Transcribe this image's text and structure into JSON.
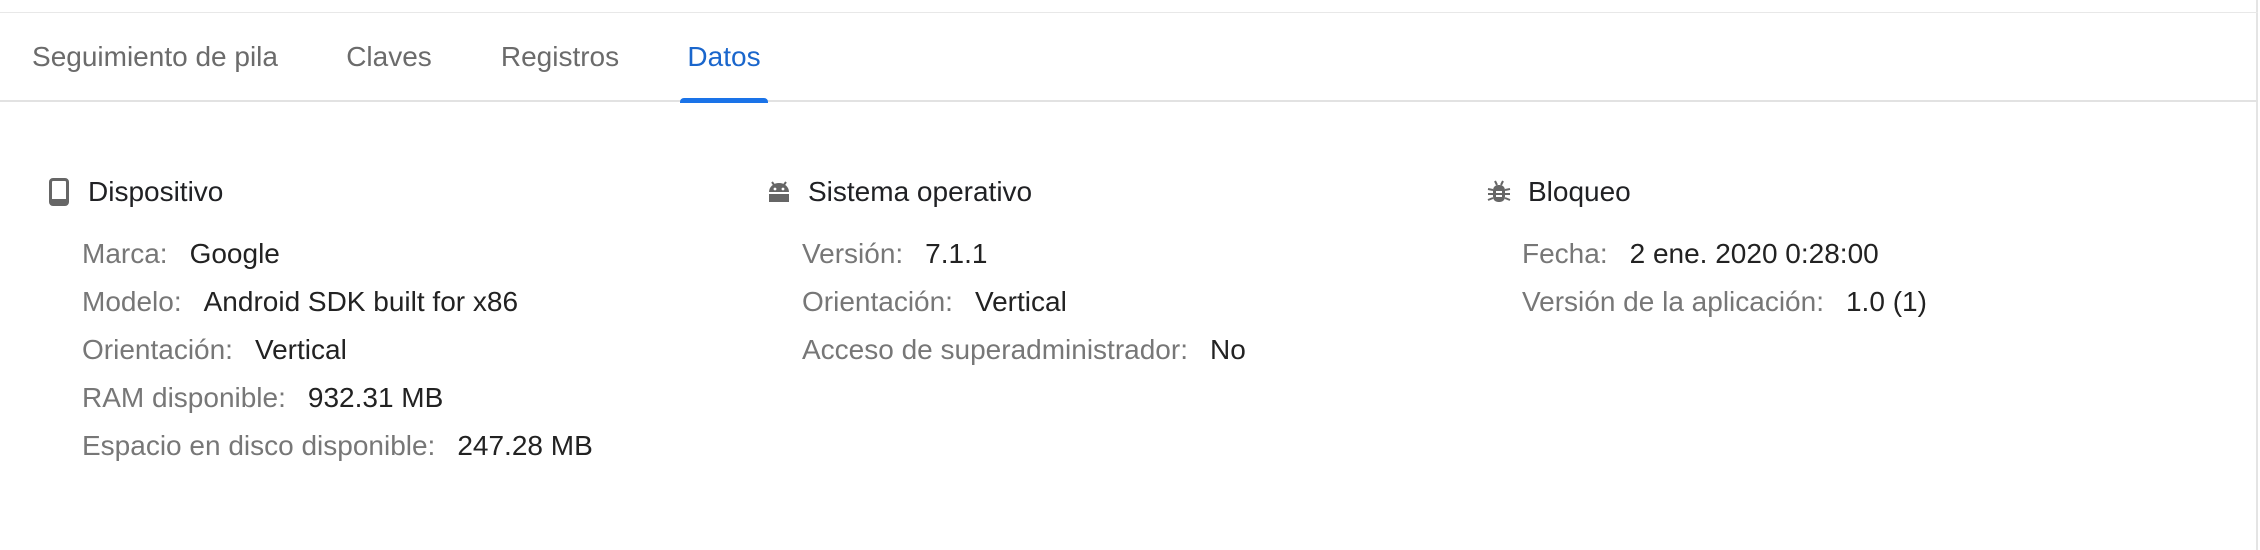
{
  "tabs": [
    {
      "label": "Seguimiento de pila",
      "active": false
    },
    {
      "label": "Claves",
      "active": false
    },
    {
      "label": "Registros",
      "active": false
    },
    {
      "label": "Datos",
      "active": true
    }
  ],
  "colors": {
    "accent": "#1a73e8",
    "active_tab_text": "#1a66cc",
    "label": "#777777",
    "value": "#222222"
  },
  "sections": {
    "device": {
      "icon": "smartphone-icon",
      "title": "Dispositivo",
      "rows": [
        {
          "label": "Marca:",
          "value": "Google"
        },
        {
          "label": "Modelo:",
          "value": "Android SDK built for x86"
        },
        {
          "label": "Orientación:",
          "value": "Vertical"
        },
        {
          "label": "RAM disponible:",
          "value": "932.31 MB"
        },
        {
          "label": "Espacio en disco disponible:",
          "value": "247.28 MB"
        }
      ]
    },
    "os": {
      "icon": "android-icon",
      "title": "Sistema operativo",
      "rows": [
        {
          "label": "Versión:",
          "value": "7.1.1"
        },
        {
          "label": "Orientación:",
          "value": "Vertical"
        },
        {
          "label": "Acceso de superadministrador:",
          "value": "No"
        }
      ]
    },
    "crash": {
      "icon": "bug-icon",
      "title": "Bloqueo",
      "rows": [
        {
          "label": "Fecha:",
          "value": "2 ene. 2020 0:28:00"
        },
        {
          "label": "Versión de la aplicación:",
          "value": "1.0 (1)"
        }
      ]
    }
  }
}
